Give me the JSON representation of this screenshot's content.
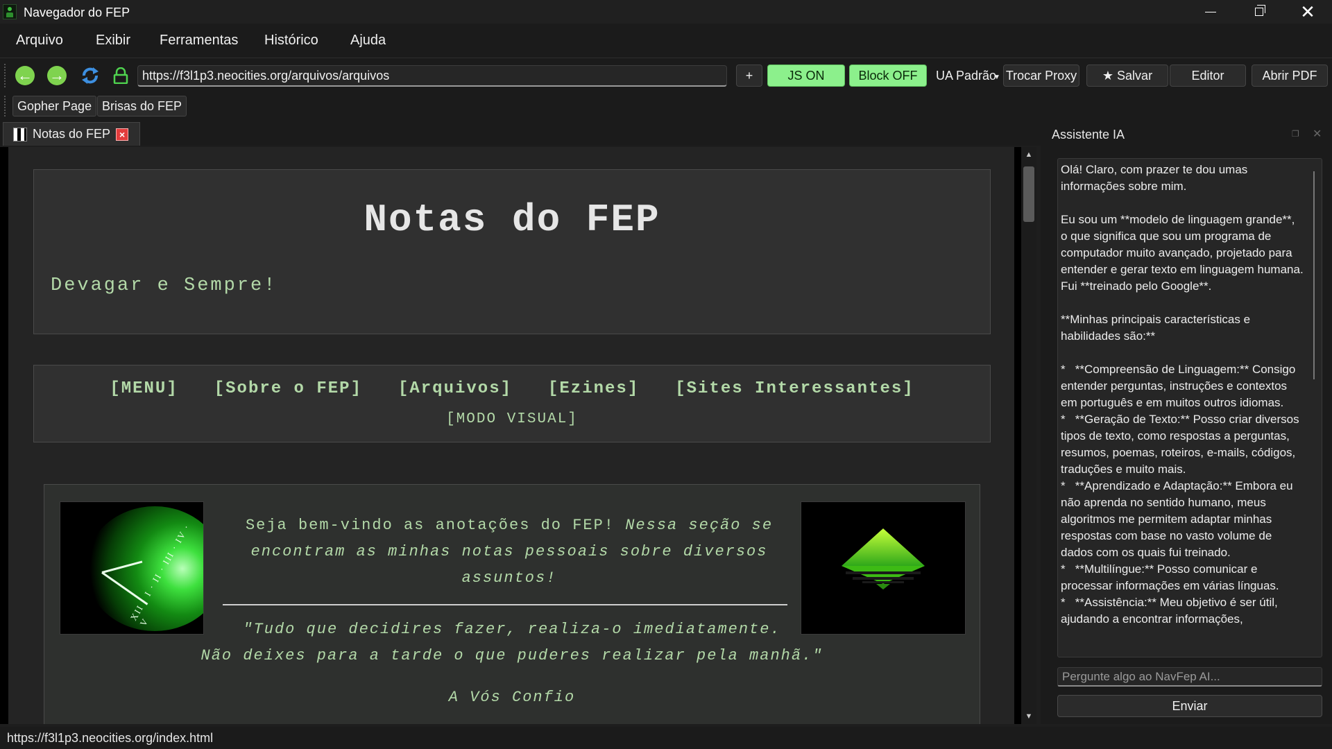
{
  "window": {
    "title": "Navegador do FEP"
  },
  "menu": {
    "items": [
      "Arquivo",
      "Exibir",
      "Ferramentas",
      "Histórico",
      "Ajuda"
    ]
  },
  "toolbar": {
    "back_icon": "back-arrow-icon",
    "forward_icon": "forward-arrow-icon",
    "reload_icon": "reload-icon",
    "lock_icon": "lock-icon",
    "url": "https://f3l1p3.neocities.org/arquivos/arquivos",
    "new_tab_label": "+",
    "js_label": "JS ON",
    "block_label": "Block OFF",
    "ua_label": "UA Padrão",
    "proxy_label": "Trocar Proxy",
    "save_label": "★ Salvar",
    "editor_label": "Editor",
    "pdf_label": "Abrir PDF",
    "accent_green": "#8cf08c"
  },
  "bookmarks": [
    "Gopher Page",
    "Brisas do FEP"
  ],
  "tabs": [
    {
      "title": "Notas do FEP",
      "close": "×"
    }
  ],
  "page": {
    "title": "Notas do FEP",
    "tagline": "Devagar e Sempre!",
    "nav": [
      "[MENU]",
      "[Sobre o FEP]",
      "[Arquivos]",
      "[Ezines]",
      "[Sites Interessantes]"
    ],
    "nav_visual": "[MODO VISUAL]",
    "intro_plain": "Seja bem-vindo as anotações do FEP!",
    "intro_italic": "Nessa seção se encontram as minhas notas pessoais sobre diversos assuntos!",
    "quote_line1": "\"Tudo que decidires fazer, realiza-o imediatamente.",
    "quote_line2": "Não deixes para a tarde o que puderes realizar pela manhã.\"",
    "quote_author": "A Vós Confio",
    "text_color": "#b3d9a8"
  },
  "assistant": {
    "title": "Assistente IA",
    "message": "Olá! Claro, com prazer te dou umas informações sobre mim.\n\nEu sou um **modelo de linguagem grande**, o que significa que sou um programa de computador muito avançado, projetado para entender e gerar texto em linguagem humana. Fui **treinado pelo Google**.\n\n**Minhas principais características e habilidades são:**\n\n*   **Compreensão de Linguagem:** Consigo entender perguntas, instruções e contextos em português e em muitos outros idiomas.\n*   **Geração de Texto:** Posso criar diversos tipos de texto, como respostas a perguntas, resumos, poemas, roteiros, e-mails, códigos, traduções e muito mais.\n*   **Aprendizado e Adaptação:** Embora eu não aprenda no sentido humano, meus algoritmos me permitem adaptar minhas respostas com base no vasto volume de dados com os quais fui treinado.\n*   **Multilíngue:** Posso comunicar e processar informações em várias línguas.\n*   **Assistência:** Meu objetivo é ser útil, ajudando a encontrar informações,",
    "input_placeholder": "Pergunte algo ao NavFep AI...",
    "send_label": "Enviar"
  },
  "status": {
    "url": "https://f3l1p3.neocities.org/index.html"
  }
}
